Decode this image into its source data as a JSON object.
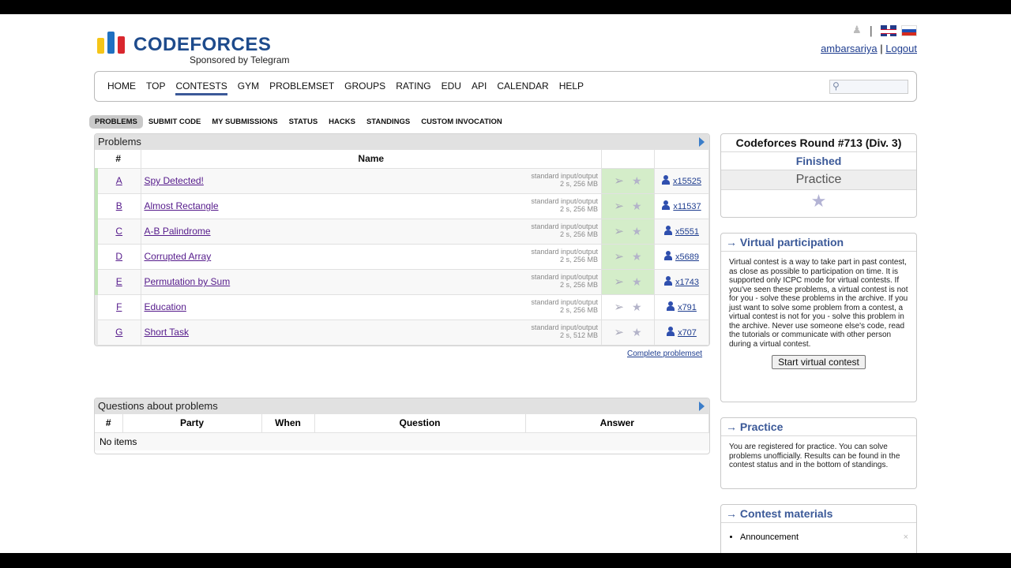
{
  "header": {
    "logo_text": "CODEFORCES",
    "logo_sub": "Sponsored by Telegram",
    "separator": "|",
    "user": "ambarsariya",
    "user_sep": "|",
    "logout": "Logout"
  },
  "menu": {
    "items": [
      "HOME",
      "TOP",
      "CONTESTS",
      "GYM",
      "PROBLEMSET",
      "GROUPS",
      "RATING",
      "EDU",
      "API",
      "CALENDAR",
      "HELP"
    ],
    "active": "CONTESTS"
  },
  "submenu": {
    "items": [
      "PROBLEMS",
      "SUBMIT CODE",
      "MY SUBMISSIONS",
      "STATUS",
      "HACKS",
      "STANDINGS",
      "CUSTOM INVOCATION"
    ],
    "active": "PROBLEMS"
  },
  "problems": {
    "title": "Problems",
    "headers": {
      "index": "#",
      "name": "Name"
    },
    "rows": [
      {
        "index": "A",
        "name": "Spy Detected!",
        "io": "standard input/output",
        "limits": "2 s, 256 MB",
        "solved": "x15525",
        "accepted": true
      },
      {
        "index": "B",
        "name": "Almost Rectangle",
        "io": "standard input/output",
        "limits": "2 s, 256 MB",
        "solved": "x11537",
        "accepted": true
      },
      {
        "index": "C",
        "name": "A-B Palindrome",
        "io": "standard input/output",
        "limits": "2 s, 256 MB",
        "solved": "x5551",
        "accepted": true
      },
      {
        "index": "D",
        "name": "Corrupted Array",
        "io": "standard input/output",
        "limits": "2 s, 256 MB",
        "solved": "x5689",
        "accepted": true
      },
      {
        "index": "E",
        "name": "Permutation by Sum",
        "io": "standard input/output",
        "limits": "2 s, 256 MB",
        "solved": "x1743",
        "accepted": true
      },
      {
        "index": "F",
        "name": "Education",
        "io": "standard input/output",
        "limits": "2 s, 256 MB",
        "solved": "x791",
        "accepted": false
      },
      {
        "index": "G",
        "name": "Short Task",
        "io": "standard input/output",
        "limits": "2 s, 512 MB",
        "solved": "x707",
        "accepted": false
      }
    ],
    "complete_link": "Complete problemset"
  },
  "questions": {
    "title": "Questions about problems",
    "headers": [
      "#",
      "Party",
      "When",
      "Question",
      "Answer"
    ],
    "empty": "No items"
  },
  "sidebar": {
    "round_name": "Codeforces Round #713 (Div. 3)",
    "round_status": "Finished",
    "round_mode": "Practice",
    "virtual_title": "→ Virtual participation",
    "virtual_text": "Virtual contest is a way to take part in past contest, as close as possible to participation on time. It is supported only ICPC mode for virtual contests. If you've seen these problems, a virtual contest is not for you - solve these problems in the archive. If you just want to solve some problem from a contest, a virtual contest is not for you - solve this problem in the archive. Never use someone else's code, read the tutorials or communicate with other person during a virtual contest.",
    "virtual_button": "Start virtual contest",
    "practice_title": "→ Practice",
    "practice_text": "You are registered for practice. You can solve problems unofficially. Results can be found in the contest status and in the bottom of standings.",
    "materials_title": "→ Contest materials",
    "materials": [
      "Announcement"
    ]
  },
  "icons": {
    "bell": "bell-icon",
    "flag_en": "uk-flag-icon",
    "flag_ru": "russia-flag-icon",
    "search": "search-icon",
    "submit": "paper-plane-icon",
    "favourite": "star-icon",
    "solvers": "user-icon"
  },
  "colors": {
    "brand_blue": "#1e4b8c",
    "accepted_green": "#d4edc9",
    "link_purple": "#551a8b"
  }
}
